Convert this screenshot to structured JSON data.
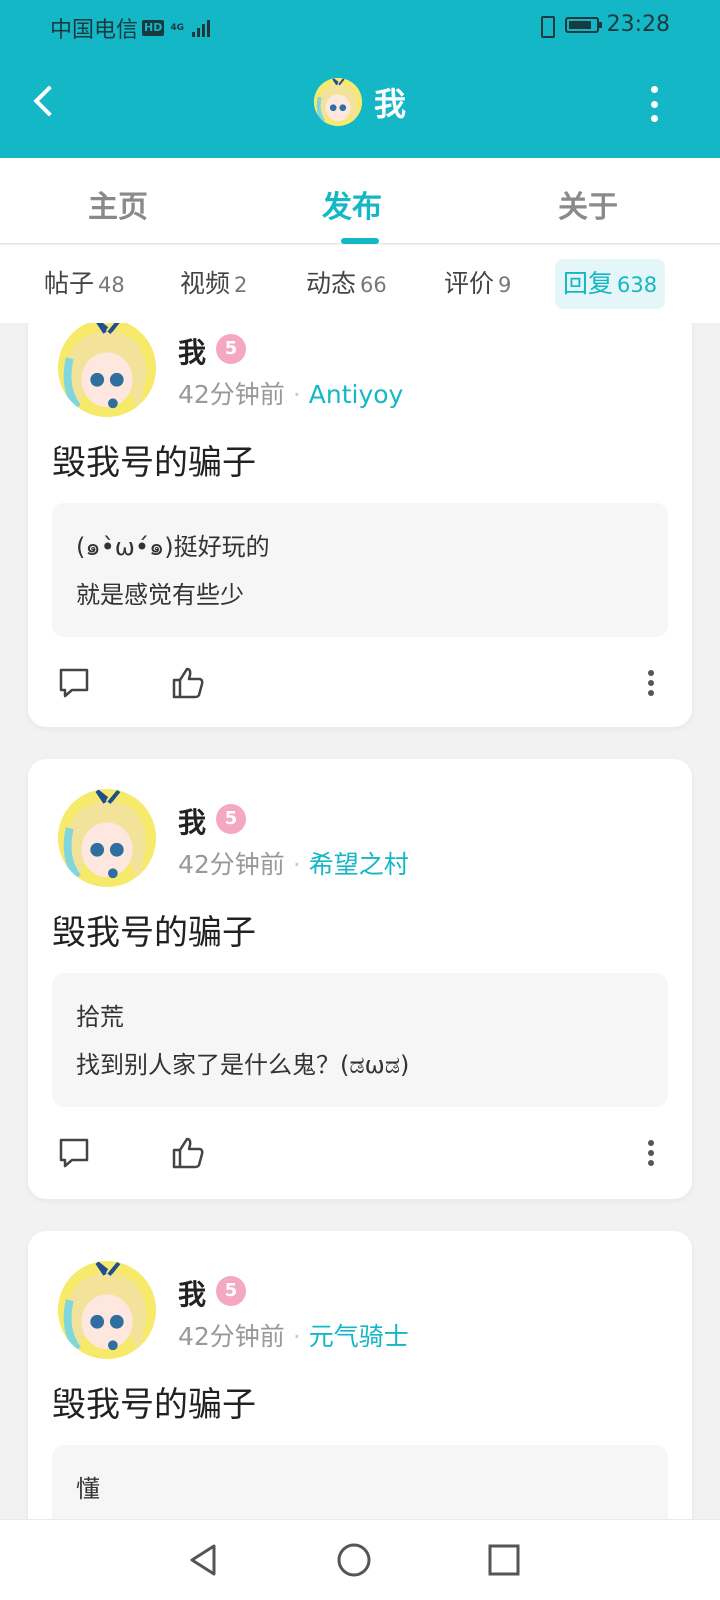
{
  "status_bar": {
    "carrier": "中国电信",
    "hd": "HD",
    "network": "4G",
    "time": "23:28"
  },
  "app_bar": {
    "title": "我"
  },
  "tabs": [
    {
      "label": "主页",
      "active": false
    },
    {
      "label": "发布",
      "active": true
    },
    {
      "label": "关于",
      "active": false
    }
  ],
  "subtabs": [
    {
      "label": "帖子",
      "count": "48",
      "active": false
    },
    {
      "label": "视频",
      "count": "2",
      "active": false
    },
    {
      "label": "动态",
      "count": "66",
      "active": false
    },
    {
      "label": "评价",
      "count": "9",
      "active": false
    },
    {
      "label": "回复",
      "count": "638",
      "active": true
    }
  ],
  "posts": [
    {
      "user": "我",
      "level": "5",
      "time": "42分钟前",
      "game": "Antiyoy",
      "title": "毁我号的骗子",
      "quote": [
        "(๑•̀ω•́๑)挺好玩的",
        "就是感觉有些少"
      ]
    },
    {
      "user": "我",
      "level": "5",
      "time": "42分钟前",
      "game": "希望之村",
      "title": "毁我号的骗子",
      "quote": [
        "拾荒",
        "找到别人家了是什么鬼？(ಡωಡ)"
      ]
    },
    {
      "user": "我",
      "level": "5",
      "time": "42分钟前",
      "game": "元气骑士",
      "title": "毁我号的骗子",
      "quote": [
        "懂"
      ]
    }
  ],
  "colors": {
    "accent": "#14b7c6",
    "level_badge": "#f5a9c0"
  }
}
